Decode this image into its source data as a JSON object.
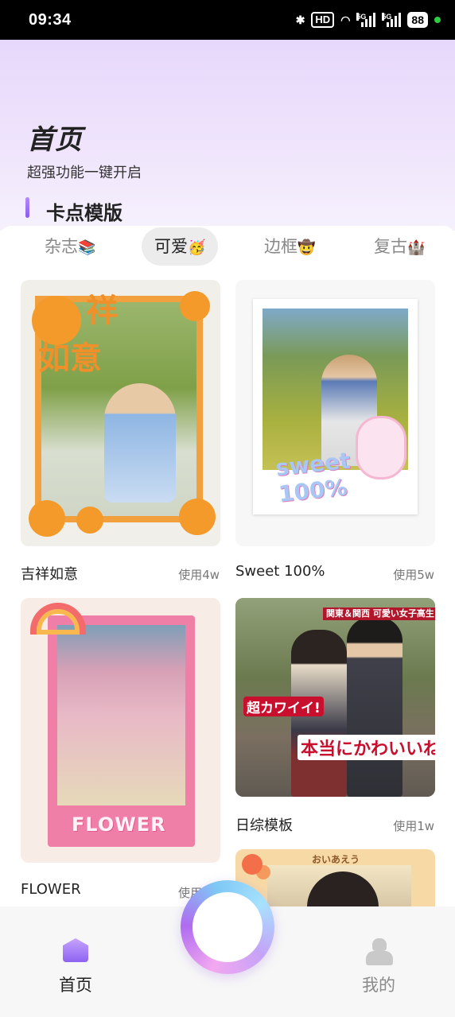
{
  "status_bar": {
    "time": "09:34",
    "hd": "HD",
    "net1": "5G",
    "net2": "5G",
    "battery": "88"
  },
  "header": {
    "title": "首页",
    "subtitle": "超强功能一键开启",
    "section_title": "卡点模版",
    "accent": "#8a5cf0"
  },
  "tabs": [
    {
      "label": "杂志",
      "emoji": "📚"
    },
    {
      "label": "可爱",
      "emoji": "🥳",
      "active": true
    },
    {
      "label": "边框",
      "emoji": "🤠"
    },
    {
      "label": "复古",
      "emoji": "🏰"
    }
  ],
  "templates": [
    {
      "name": "吉祥如意",
      "usage": "使用4w",
      "thumb_text": [
        "祥",
        "如意"
      ]
    },
    {
      "name": "Sweet 100%",
      "usage": "使用5w",
      "thumb_text": [
        "sweet 100%"
      ]
    },
    {
      "name": "FLOWER",
      "usage": "使用",
      "thumb_text": [
        "FLOWER"
      ]
    },
    {
      "name": "日综模板",
      "usage": "使用1w",
      "thumb_text": [
        "関東＆関西 可愛い女子高生",
        "超カワイイ!",
        "本当にかわいいね!"
      ]
    },
    {
      "name": "",
      "usage": "",
      "thumb_text": [
        "おいあえう"
      ]
    }
  ],
  "bottom_nav": {
    "home_label": "首页",
    "profile_label": "我的",
    "home_icon": "home-icon",
    "profile_icon": "user-icon",
    "create_icon": "create-ring-icon"
  }
}
